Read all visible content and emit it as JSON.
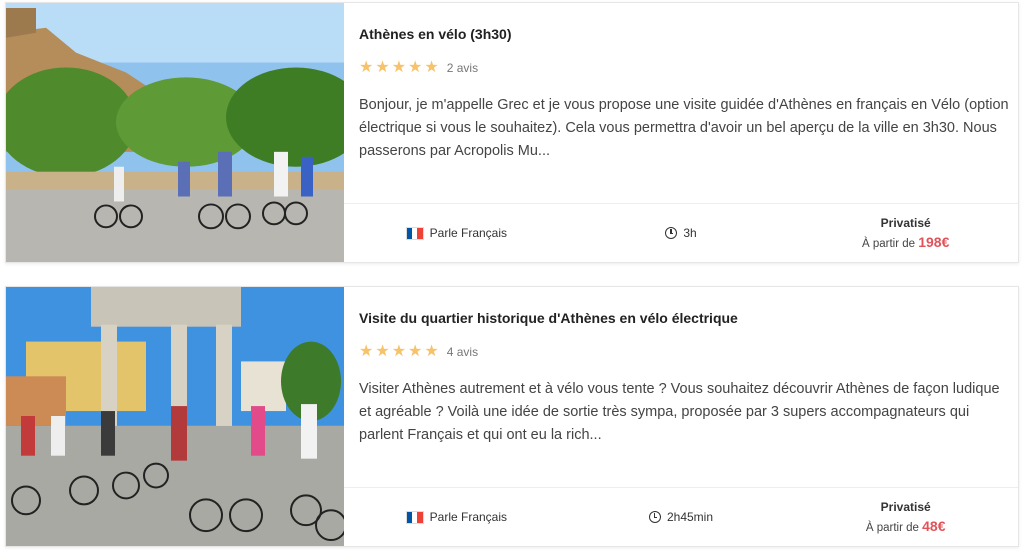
{
  "tours": [
    {
      "title": "Athènes en vélo (3h30)",
      "reviews": "2 avis",
      "rating": 5,
      "description": "Bonjour, je m'appelle Grec et je vous propose une visite guidée d'Athènes en français en Vélo (option électrique si vous le souhaitez). Cela vous permettra d'avoir un bel aperçu de la ville en 3h30. Nous passerons par Acropolis Mu...",
      "language": "Parle Français",
      "duration": "3h",
      "type": "Privatisé",
      "price_prefix": "À partir de",
      "price": "198€"
    },
    {
      "title": "Visite du quartier historique d'Athènes en vélo électrique",
      "reviews": "4 avis",
      "rating": 5,
      "description": "Visiter Athènes autrement et à vélo vous tente ? Vous souhaitez découvrir Athènes de façon ludique et agréable ? Voilà une idée de sortie très sympa, proposée par 3 supers accompagnateurs qui parlent Français et qui ont eu la rich...",
      "language": "Parle Français",
      "duration": "2h45min",
      "type": "Privatisé",
      "price_prefix": "À partir de",
      "price": "48€"
    }
  ],
  "colors": {
    "star": "#f6c36a",
    "price": "#e1535a",
    "flag_blue": "#0055a4",
    "flag_red": "#ef4135"
  },
  "icons": {
    "language": "french-flag-icon",
    "duration": "clock-icon",
    "rating": "star-icon"
  }
}
